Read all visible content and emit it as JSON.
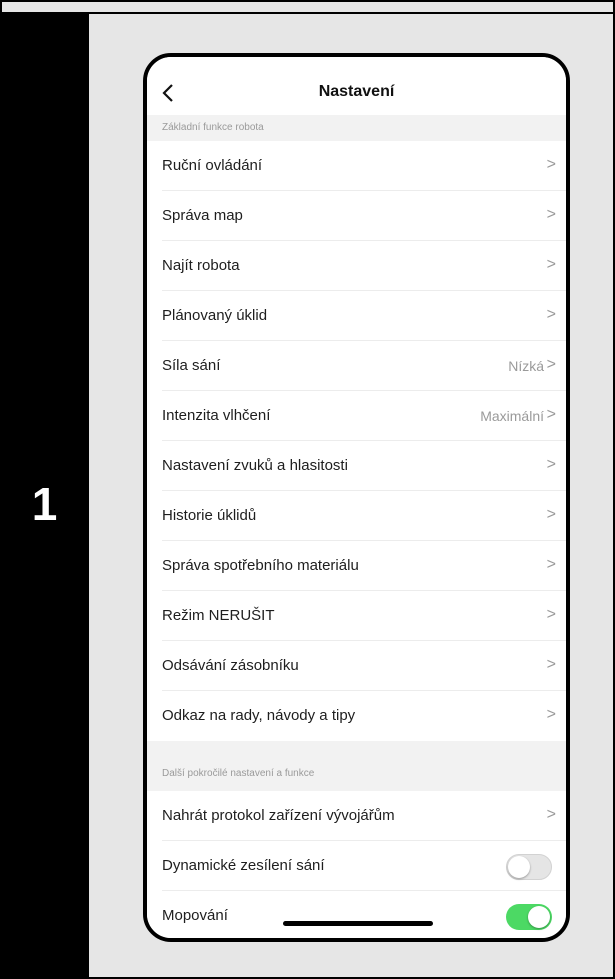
{
  "step": {
    "number": "1"
  },
  "header": {
    "back_icon": "chevron-left-icon",
    "title": "Nastavení"
  },
  "sections": [
    {
      "title": "Základní funkce robota"
    },
    {
      "title": "Další pokročilé nastavení a funkce"
    }
  ],
  "basic_items": [
    {
      "label": "Ruční ovládání",
      "value": ""
    },
    {
      "label": "Správa map",
      "value": ""
    },
    {
      "label": "Najít robota",
      "value": ""
    },
    {
      "label": "Plánovaný úklid",
      "value": ""
    },
    {
      "label": "Síla sání",
      "value": "Nízká"
    },
    {
      "label": "Intenzita vlhčení",
      "value": "Maximální"
    },
    {
      "label": "Nastavení zvuků a hlasitosti",
      "value": ""
    },
    {
      "label": "Historie úklidů",
      "value": ""
    },
    {
      "label": "Správa spotřebního materiálu",
      "value": ""
    },
    {
      "label": "Režim NERUŠIT",
      "value": ""
    },
    {
      "label": "Odsávání zásobníku",
      "value": ""
    },
    {
      "label": "Odkaz na rady, návody a tipy",
      "value": ""
    }
  ],
  "advanced_items": [
    {
      "label": "Nahrát protokol zařízení vývojářům",
      "type": "link"
    },
    {
      "label": "Dynamické zesílení sání",
      "type": "toggle",
      "state": "off"
    },
    {
      "label": "Mopování",
      "type": "toggle",
      "state": "on"
    }
  ],
  "chevron_glyph": ">",
  "colors": {
    "toggle_on": "#4cd964",
    "toggle_off": "#e5e5e5",
    "secondary_text": "#9a9a9a"
  }
}
